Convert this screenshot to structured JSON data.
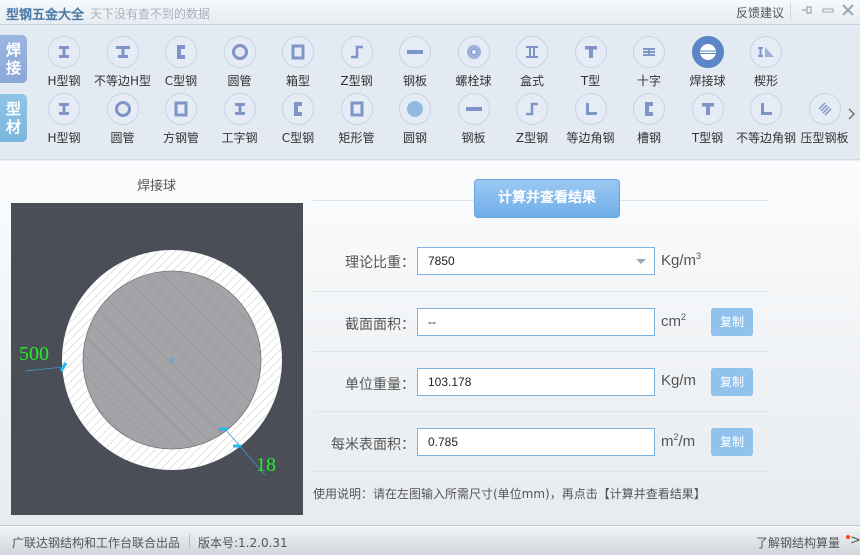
{
  "titlebar": {
    "app_title": "型钢五金大全",
    "slogan": "天下没有查不到的数据",
    "feedback": "反馈建议",
    "pin": "⊣",
    "minimize": "—",
    "close": "✕"
  },
  "categories": {
    "weld": "焊接",
    "profile": "型材"
  },
  "weld_tools": [
    {
      "label": "H型钢",
      "icon": "h-beam-icon"
    },
    {
      "label": "不等边H型",
      "icon": "unequal-h-beam-icon"
    },
    {
      "label": "C型钢",
      "icon": "c-channel-icon"
    },
    {
      "label": "圆管",
      "icon": "round-tube-icon"
    },
    {
      "label": "箱型",
      "icon": "box-section-icon"
    },
    {
      "label": "Z型钢",
      "icon": "z-section-icon"
    },
    {
      "label": "钢板",
      "icon": "steel-plate-icon"
    },
    {
      "label": "螺栓球",
      "icon": "bolt-ball-icon"
    },
    {
      "label": "盒式",
      "icon": "box-type-icon"
    },
    {
      "label": "T型",
      "icon": "t-section-icon"
    },
    {
      "label": "十字",
      "icon": "cross-section-icon"
    },
    {
      "label": "焊接球",
      "icon": "welded-ball-icon",
      "active": true
    },
    {
      "label": "楔形",
      "icon": "wedge-icon"
    }
  ],
  "profile_tools": [
    {
      "label": "H型钢",
      "icon": "h-beam-icon"
    },
    {
      "label": "圆管",
      "icon": "round-tube-icon"
    },
    {
      "label": "方钢管",
      "icon": "square-tube-icon"
    },
    {
      "label": "工字钢",
      "icon": "i-beam-icon"
    },
    {
      "label": "C型钢",
      "icon": "c-channel-icon"
    },
    {
      "label": "矩形管",
      "icon": "rect-tube-icon"
    },
    {
      "label": "圆钢",
      "icon": "round-bar-icon"
    },
    {
      "label": "钢板",
      "icon": "steel-plate-icon"
    },
    {
      "label": "Z型钢",
      "icon": "z-section-icon"
    },
    {
      "label": "等边角钢",
      "icon": "equal-angle-icon"
    },
    {
      "label": "槽钢",
      "icon": "channel-icon"
    },
    {
      "label": "T型钢",
      "icon": "t-section-icon"
    },
    {
      "label": "不等边角钢",
      "icon": "unequal-angle-icon"
    },
    {
      "label": "压型钢板",
      "icon": "profiled-sheet-icon"
    }
  ],
  "figure": {
    "title": "焊接球",
    "diameter": "500",
    "thickness": "18"
  },
  "calc": {
    "button": "计算并查看结果",
    "density_label": "理论比重：",
    "density_value": "7850",
    "density_unit": "Kg/m",
    "density_unit_sup": "3",
    "area_label": "截面面积：",
    "area_value": "--",
    "area_unit": "cm",
    "area_unit_sup": "2",
    "weight_label": "单位重量：",
    "weight_value": "103.178",
    "weight_unit": "Kg/m",
    "surface_label": "每米表面积：",
    "surface_value": "0.785",
    "surface_unit_pre": "m",
    "surface_unit_sup": "2",
    "surface_unit_post": "/m",
    "copy": "复制",
    "usage": "使用说明：请在左图输入所需尺寸(单位mm)，再点击【计算并查看结果】"
  },
  "status": {
    "left": "广联达钢结构和工作台联合出品",
    "version": "版本号:1.2.0.31",
    "right": "了解钢结构算量",
    "arrow": ">"
  },
  "colors": {
    "accent": "#5b87c6",
    "button": "#6eaee8",
    "dimension_text": "#22ee22"
  }
}
